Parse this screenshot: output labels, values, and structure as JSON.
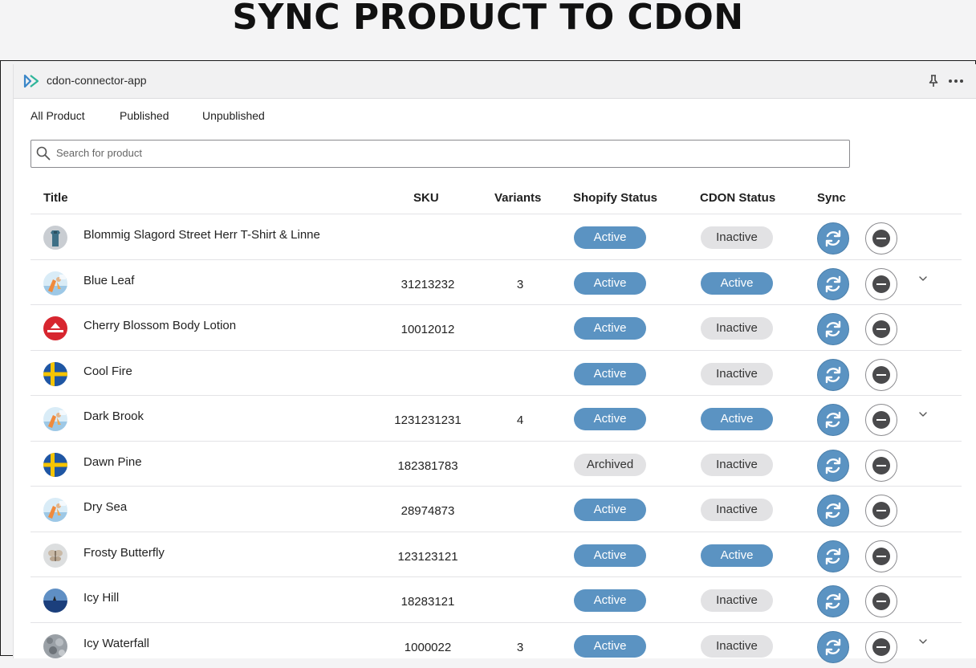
{
  "banner": {
    "title": "SYNC PRODUCT TO CDON"
  },
  "app": {
    "title": "cdon-connector-app"
  },
  "tabs": [
    {
      "label": "All Product"
    },
    {
      "label": "Published"
    },
    {
      "label": "Unpublished"
    }
  ],
  "search": {
    "placeholder": "Search for product",
    "value": ""
  },
  "table": {
    "headers": {
      "title": "Title",
      "sku": "SKU",
      "variants": "Variants",
      "shopify_status": "Shopify Status",
      "cdon_status": "CDON Status",
      "sync": "Sync"
    },
    "rows": [
      {
        "title": "Blommig Slagord Street Herr T-Shirt & Linne",
        "sku": "",
        "variants": "",
        "shopify_status": "Active",
        "cdon_status": "Inactive",
        "expandable": false,
        "thumb": "tshirt"
      },
      {
        "title": "Blue Leaf",
        "sku": "31213232",
        "variants": "3",
        "shopify_status": "Active",
        "cdon_status": "Active",
        "expandable": true,
        "thumb": "surf"
      },
      {
        "title": "Cherry Blossom Body Lotion",
        "sku": "10012012",
        "variants": "",
        "shopify_status": "Active",
        "cdon_status": "Inactive",
        "expandable": false,
        "thumb": "foodora"
      },
      {
        "title": "Cool Fire",
        "sku": "",
        "variants": "",
        "shopify_status": "Active",
        "cdon_status": "Inactive",
        "expandable": false,
        "thumb": "sweden"
      },
      {
        "title": "Dark Brook",
        "sku": "1231231231",
        "variants": "4",
        "shopify_status": "Active",
        "cdon_status": "Active",
        "expandable": true,
        "thumb": "surf"
      },
      {
        "title": "Dawn Pine",
        "sku": "182381783",
        "variants": "",
        "shopify_status": "Archived",
        "cdon_status": "Inactive",
        "expandable": false,
        "thumb": "sweden"
      },
      {
        "title": "Dry Sea",
        "sku": "28974873",
        "variants": "",
        "shopify_status": "Active",
        "cdon_status": "Inactive",
        "expandable": false,
        "thumb": "surf"
      },
      {
        "title": "Frosty Butterfly",
        "sku": "123123121",
        "variants": "",
        "shopify_status": "Active",
        "cdon_status": "Active",
        "expandable": false,
        "thumb": "butterfly"
      },
      {
        "title": "Icy Hill",
        "sku": "18283121",
        "variants": "",
        "shopify_status": "Active",
        "cdon_status": "Inactive",
        "expandable": false,
        "thumb": "sea"
      },
      {
        "title": "Icy Waterfall",
        "sku": "1000022",
        "variants": "3",
        "shopify_status": "Active",
        "cdon_status": "Inactive",
        "expandable": true,
        "thumb": "rocks"
      }
    ]
  },
  "colors": {
    "active_badge": "#5b93c2",
    "inactive_badge": "#e2e2e4",
    "sync_button": "#5b93c2"
  },
  "icons": {
    "logo": "cdon-logo-icon",
    "pin": "pin-icon",
    "more": "more-horizontal-icon",
    "search": "search-icon",
    "sync": "sync-icon",
    "remove": "remove-icon",
    "expand": "chevron-down-icon"
  }
}
